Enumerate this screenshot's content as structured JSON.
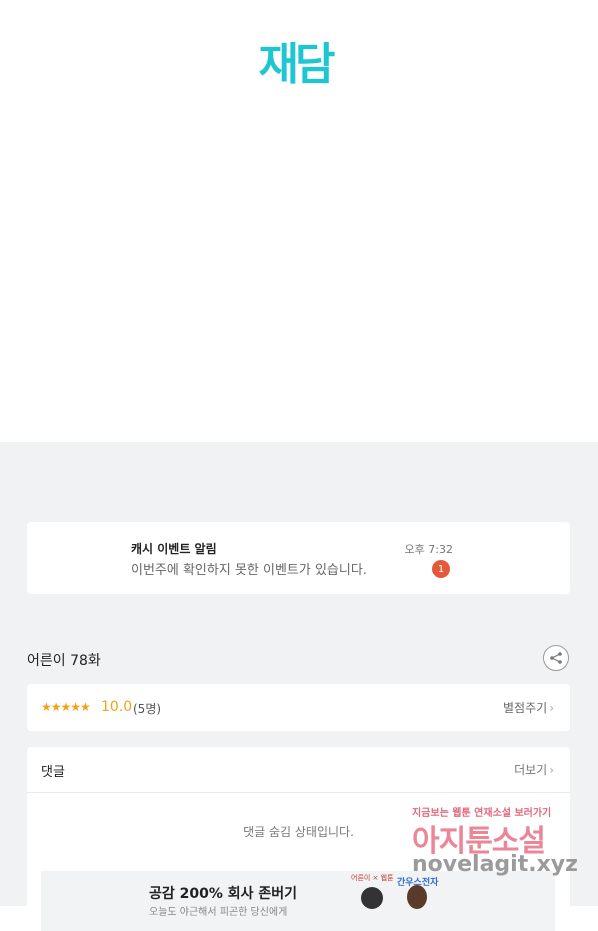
{
  "brand": {
    "logo_text": "재담",
    "accent_color": "#1ec6d3"
  },
  "notification": {
    "title": "캐시 이벤트 알림",
    "message": "이번주에 확인하지 못한 이벤트가 있습니다.",
    "time": "오후 7:32",
    "badge_count": "1",
    "badge_color": "#e4593a"
  },
  "episode": {
    "title": "어른이 78화",
    "share_icon": "share-icon"
  },
  "rating": {
    "stars": "★★★★★",
    "score": "10.0",
    "count": "(5명)",
    "action_label": "별점주기",
    "star_color": "#f0a316"
  },
  "comments": {
    "title": "댓글",
    "more_label": "더보기",
    "hidden_message": "댓글 숨김 상태입니다."
  },
  "banner": {
    "title": "공감 200% 회사 존버기",
    "subtitle": "오늘도 야근해서 피곤한 당신에게",
    "label": "어른이 × 웹툰",
    "brand_text": "간우스전자"
  },
  "watermark": {
    "line1": "지금보는 웹툰 연재소설 보러가기",
    "line2": "아지툰소설",
    "line3": "novelagit.xyz"
  }
}
